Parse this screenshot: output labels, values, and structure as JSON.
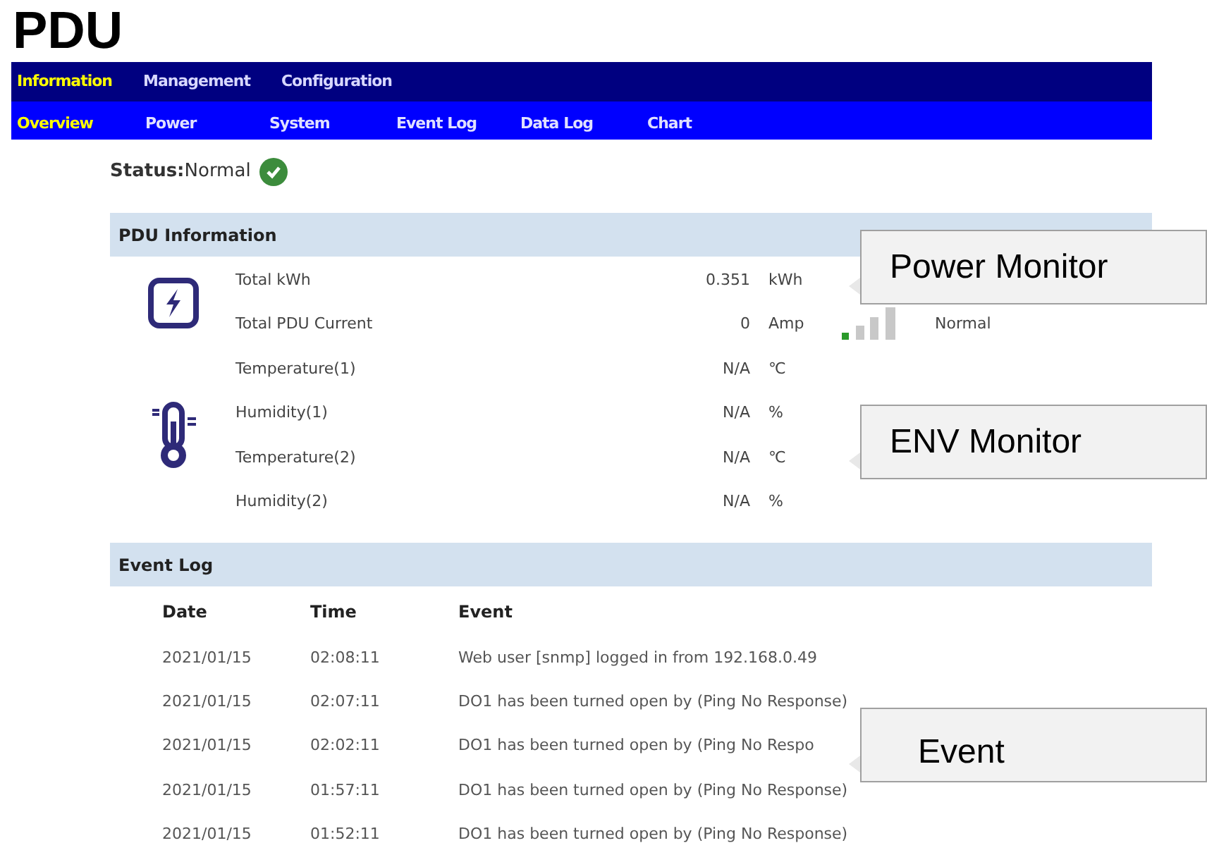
{
  "title": "PDU",
  "main_menu": [
    {
      "label": "Information",
      "selected": true
    },
    {
      "label": "Management",
      "selected": false
    },
    {
      "label": "Configuration",
      "selected": false
    }
  ],
  "sub_menu": [
    {
      "label": "Overview",
      "selected": true
    },
    {
      "label": "Power",
      "selected": false
    },
    {
      "label": "System",
      "selected": false
    },
    {
      "label": "Event Log",
      "selected": false
    },
    {
      "label": "Data Log",
      "selected": false
    },
    {
      "label": "Chart",
      "selected": false
    }
  ],
  "status": {
    "text": "**Status:**Normal",
    "ok": true
  },
  "pdu_information": {
    "title": "PDU Information",
    "groups": [
      {
        "kind": "power",
        "rows": [
          {
            "label": "Total kWh",
            "value": "0.351",
            "unit": "kWh"
          },
          {
            "label": "Total PDU Current",
            "value": "0",
            "unit": "Amp",
            "load_status": "Normal"
          }
        ]
      },
      {
        "kind": "environment",
        "rows": [
          {
            "label": "Temperature(1)",
            "value": "N/A",
            "unit": "℃"
          },
          {
            "label": "Humidity(1)",
            "value": "N/A",
            "unit": "%"
          },
          {
            "label": "Temperature(2)",
            "value": "N/A",
            "unit": "℃"
          },
          {
            "label": "Humidity(2)",
            "value": "N/A",
            "unit": "%"
          }
        ]
      }
    ]
  },
  "event_log": {
    "title": "Event Log",
    "columns": [
      "Date",
      "Time",
      "Event"
    ],
    "rows": [
      [
        "2021/01/15",
        "02:08:11",
        "Web user [snmp] logged in from 192.168.0.49"
      ],
      [
        "2021/01/15",
        "02:07:11",
        "DO1 has been turned open by (Ping No Response)"
      ],
      [
        "2021/01/15",
        "02:02:11",
        "DO1 has been turned open by (Ping No Respo"
      ],
      [
        "2021/01/15",
        "01:57:11",
        "DO1 has been turned open by (Ping No Response)"
      ],
      [
        "2021/01/15",
        "01:52:11",
        "DO1 has been turned open by (Ping No Response)"
      ]
    ]
  },
  "callouts": [
    {
      "text": "Power Monitor"
    },
    {
      "text": "ENV Monitor"
    },
    {
      "text": "Event"
    }
  ]
}
